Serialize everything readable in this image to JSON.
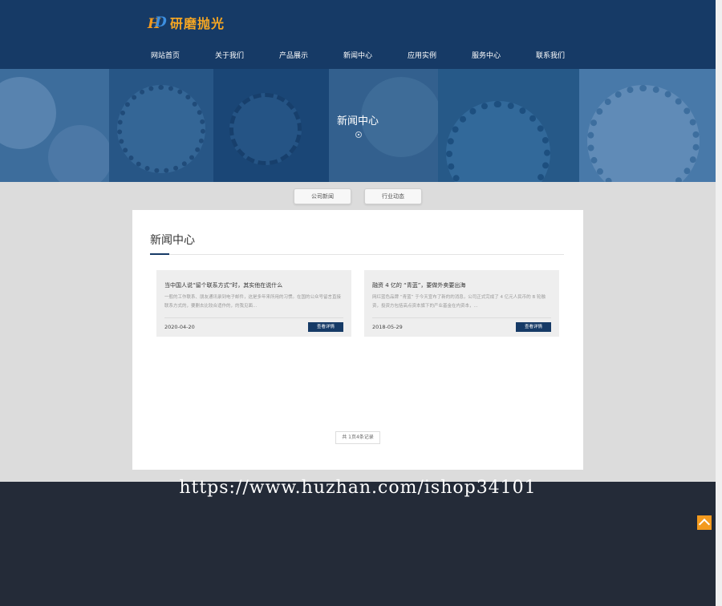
{
  "header": {
    "logo_mark": "HD",
    "logo_text": "研磨抛光",
    "nav": [
      "网站首页",
      "关于我们",
      "产品展示",
      "新闻中心",
      "应用实例",
      "服务中心",
      "联系我们"
    ]
  },
  "banner": {
    "title": "新闻中心"
  },
  "subtabs": [
    "公司新闻",
    "行业动态"
  ],
  "content": {
    "title": "新闻中心",
    "news": [
      {
        "title": "当中国人说“留个联系方式”时，其实他在说什么",
        "summary": "一般的工作联系、朋友通讯录到电子邮件，这是多年来所用的习惯。在国的公众号留言直接联系方式的，要删去比较合适作的，的我见面...",
        "date": "2020-04-20",
        "button": "查看详情"
      },
      {
        "title": "融资 4 亿的 “青蓝”，要做外卖要出海",
        "summary": "网红蓝色品牌 “青蓝” 于今天宣布了新的的消息，公司正式完成了 4 亿元人民币的 B 轮融资，投资方包括高点资本旗下的产业基金在内资本，...",
        "date": "2018-05-29",
        "button": "查看详情"
      }
    ],
    "pager": "共 1页4条记录"
  },
  "footer": {
    "watermark": "https://www.huzhan.com/ishop34101"
  },
  "colors": {
    "header_bg": "#163a66",
    "accent_orange": "#f39a1e",
    "footer_bg": "#242b38"
  },
  "icons": {
    "back_to_top": "chevron-up-icon"
  }
}
